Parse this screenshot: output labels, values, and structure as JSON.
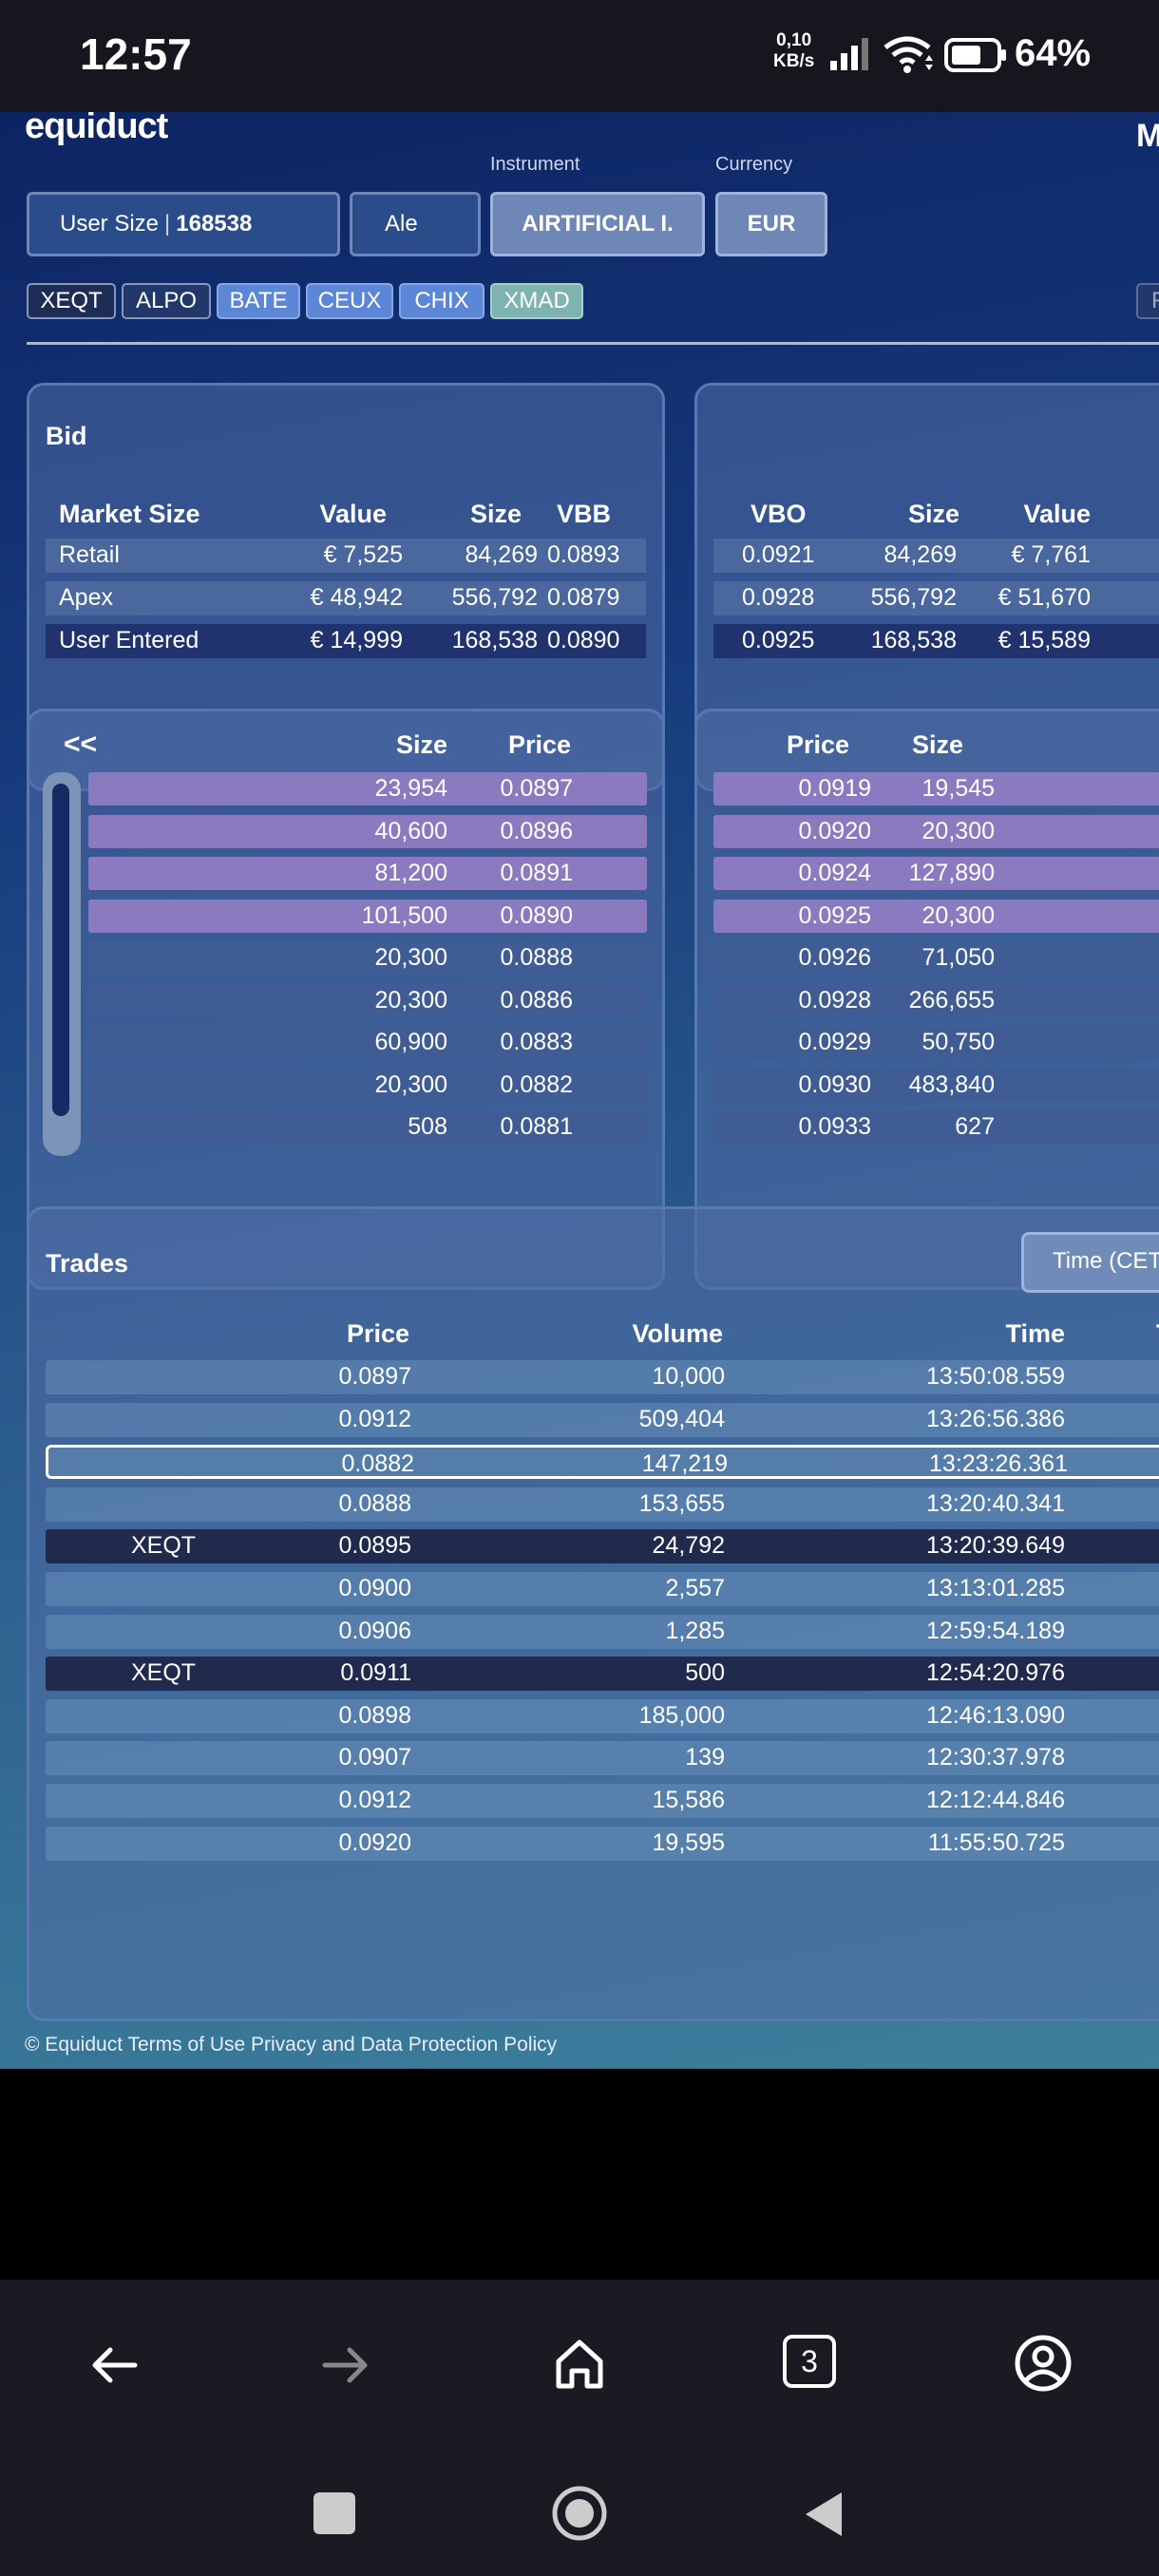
{
  "status_bar": {
    "time": "12:57",
    "net_speed_value": "0,10",
    "net_speed_unit": "KB/s",
    "battery": "64%"
  },
  "app": {
    "brand": "equiduct",
    "brand_right": "M",
    "labels": {
      "instrument": "Instrument",
      "currency": "Currency"
    },
    "user_size": {
      "label": "User Size",
      "value": "168538"
    },
    "name_field": "Ale",
    "instrument_value": "AIRTIFICIAL I.",
    "currency_value": "EUR",
    "venues": [
      "XEQT",
      "ALPO",
      "BATE",
      "CEUX",
      "CHIX",
      "XMAD"
    ],
    "venue_right_fragment": "F"
  },
  "bid_panel": {
    "title": "Bid",
    "columns": [
      "Market Size",
      "Value",
      "Size",
      "VBB"
    ],
    "rows": [
      {
        "name": "Retail",
        "value": "€ 7,525",
        "size": "84,269",
        "vbb": "0.0893"
      },
      {
        "name": "Apex",
        "value": "€ 48,942",
        "size": "556,792",
        "vbb": "0.0879"
      },
      {
        "name": "User Entered",
        "value": "€ 14,999",
        "size": "168,538",
        "vbb": "0.0890"
      }
    ]
  },
  "ask_panel": {
    "columns": [
      "VBO",
      "Size",
      "Value"
    ],
    "rows": [
      {
        "vbo": "0.0921",
        "size": "84,269",
        "value": "€ 7,761"
      },
      {
        "vbo": "0.0928",
        "size": "556,792",
        "value": "€ 51,670"
      },
      {
        "vbo": "0.0925",
        "size": "168,538",
        "value": "€ 15,589"
      }
    ]
  },
  "bid_book": {
    "back_label": "<<",
    "columns": [
      "Size",
      "Price"
    ],
    "rows": [
      {
        "size": "23,954",
        "price": "0.0897",
        "highlight": true
      },
      {
        "size": "40,600",
        "price": "0.0896",
        "highlight": true
      },
      {
        "size": "81,200",
        "price": "0.0891",
        "highlight": true
      },
      {
        "size": "101,500",
        "price": "0.0890",
        "highlight": true
      },
      {
        "size": "20,300",
        "price": "0.0888",
        "highlight": false
      },
      {
        "size": "20,300",
        "price": "0.0886",
        "highlight": false
      },
      {
        "size": "60,900",
        "price": "0.0883",
        "highlight": false
      },
      {
        "size": "20,300",
        "price": "0.0882",
        "highlight": false
      },
      {
        "size": "508",
        "price": "0.0881",
        "highlight": false
      }
    ]
  },
  "ask_book": {
    "columns": [
      "Price",
      "Size"
    ],
    "rows": [
      {
        "price": "0.0919",
        "size": "19,545",
        "highlight": true
      },
      {
        "price": "0.0920",
        "size": "20,300",
        "highlight": true
      },
      {
        "price": "0.0924",
        "size": "127,890",
        "highlight": true
      },
      {
        "price": "0.0925",
        "size": "20,300",
        "highlight": true
      },
      {
        "price": "0.0926",
        "size": "71,050",
        "highlight": false
      },
      {
        "price": "0.0928",
        "size": "266,655",
        "highlight": false
      },
      {
        "price": "0.0929",
        "size": "50,750",
        "highlight": false
      },
      {
        "price": "0.0930",
        "size": "483,840",
        "highlight": false
      },
      {
        "price": "0.0933",
        "size": "627",
        "highlight": false
      }
    ]
  },
  "trades": {
    "title": "Trades",
    "time_button": "Time (CET",
    "columns": [
      "Price",
      "Volume",
      "Time",
      "T"
    ],
    "rows": [
      {
        "venue": "",
        "price": "0.0897",
        "volume": "10,000",
        "time": "13:50:08.559",
        "style": "normal"
      },
      {
        "venue": "",
        "price": "0.0912",
        "volume": "509,404",
        "time": "13:26:56.386",
        "style": "normal"
      },
      {
        "venue": "",
        "price": "0.0882",
        "volume": "147,219",
        "time": "13:23:26.361",
        "style": "selected"
      },
      {
        "venue": "",
        "price": "0.0888",
        "volume": "153,655",
        "time": "13:20:40.341",
        "style": "normal"
      },
      {
        "venue": "XEQT",
        "price": "0.0895",
        "volume": "24,792",
        "time": "13:20:39.649",
        "style": "dark"
      },
      {
        "venue": "",
        "price": "0.0900",
        "volume": "2,557",
        "time": "13:13:01.285",
        "style": "normal"
      },
      {
        "venue": "",
        "price": "0.0906",
        "volume": "1,285",
        "time": "12:59:54.189",
        "style": "normal"
      },
      {
        "venue": "XEQT",
        "price": "0.0911",
        "volume": "500",
        "time": "12:54:20.976",
        "style": "dark"
      },
      {
        "venue": "",
        "price": "0.0898",
        "volume": "185,000",
        "time": "12:46:13.090",
        "style": "normal"
      },
      {
        "venue": "",
        "price": "0.0907",
        "volume": "139",
        "time": "12:30:37.978",
        "style": "normal"
      },
      {
        "venue": "",
        "price": "0.0912",
        "volume": "15,586",
        "time": "12:12:44.846",
        "style": "normal"
      },
      {
        "venue": "",
        "price": "0.0920",
        "volume": "19,595",
        "time": "11:55:50.725",
        "style": "normal"
      }
    ]
  },
  "footer": "© Equiduct Terms of Use Privacy and Data Protection Policy",
  "browser_nav": {
    "tabs_count": "3"
  },
  "colors": {
    "highlight_row": "#8c7ac0",
    "normal_row": "#3f5d94",
    "dark_row": "#1f2a4c",
    "venue_blue": "#5b87d6",
    "venue_green": "#7eb3b0"
  }
}
